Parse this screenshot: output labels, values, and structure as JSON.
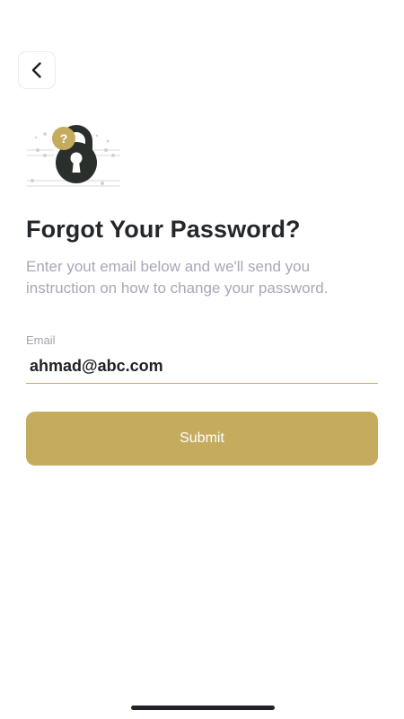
{
  "header": {
    "back_icon": "chevron-left-icon"
  },
  "illustration": {
    "icon": "padlock-question-icon",
    "question_mark": "?"
  },
  "content": {
    "title": "Forgot Your Password?",
    "subtitle": "Enter yout email below and we'll send you instruction on how to change your password."
  },
  "form": {
    "email_label": "Email",
    "email_value": "ahmad@abc.com",
    "submit_label": "Submit"
  },
  "colors": {
    "accent": "#c5ab5e",
    "title": "#23272a",
    "muted": "#a7a8b7",
    "lock": "#2b2f2c"
  }
}
